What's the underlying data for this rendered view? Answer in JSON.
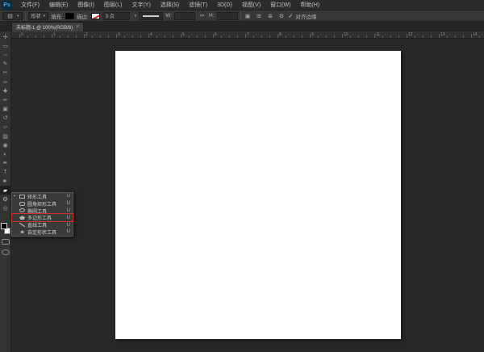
{
  "app": {
    "logo": "Ps"
  },
  "menubar": {
    "items": [
      {
        "label": "文件(F)"
      },
      {
        "label": "编辑(E)"
      },
      {
        "label": "图像(I)"
      },
      {
        "label": "图层(L)"
      },
      {
        "label": "文字(Y)"
      },
      {
        "label": "选择(S)"
      },
      {
        "label": "滤镜(T)"
      },
      {
        "label": "3D(D)"
      },
      {
        "label": "视图(V)"
      },
      {
        "label": "窗口(W)"
      },
      {
        "label": "帮助(H)"
      }
    ]
  },
  "options": {
    "preset_glyph": "▤",
    "preset_arrow": "▾",
    "shape_mode": "形状",
    "shape_mode_arrow": "▾",
    "fill_label": "填充:",
    "stroke_label": "描边:",
    "stroke_width": "3 点",
    "stroke_width_arrow": "▾",
    "w_label": "W:",
    "link_glyph": "∞",
    "h_label": "H:",
    "combine_glyph": "▣",
    "align_glyph": "⊞",
    "arrange_glyph": "≣",
    "gear_glyph": "⚙",
    "check_glyph": "✓",
    "align_edges_label": "对齐边缘"
  },
  "tab": {
    "title": "未标题-1 @ 100%(RGB/8)",
    "close": "×"
  },
  "ruler": {
    "numbers": [
      "0",
      "1",
      "2",
      "3",
      "4",
      "5",
      "6",
      "7",
      "8",
      "9",
      "10",
      "11",
      "12",
      "13",
      "14"
    ],
    "spacing_px": 40
  },
  "toolbar": {
    "tools": [
      {
        "name": "move-tool",
        "glyph": "✛"
      },
      {
        "name": "marquee-tool",
        "glyph": "▭"
      },
      {
        "name": "lasso-tool",
        "glyph": "∽"
      },
      {
        "name": "quick-selection-tool",
        "glyph": "✎"
      },
      {
        "name": "crop-tool",
        "glyph": "✂"
      },
      {
        "name": "eyedropper-tool",
        "glyph": "✑"
      },
      {
        "name": "healing-brush-tool",
        "glyph": "✚"
      },
      {
        "name": "brush-tool",
        "glyph": "✏"
      },
      {
        "name": "clone-stamp-tool",
        "glyph": "▣"
      },
      {
        "name": "history-brush-tool",
        "glyph": "↺"
      },
      {
        "name": "eraser-tool",
        "glyph": "▱"
      },
      {
        "name": "gradient-tool",
        "glyph": "▨"
      },
      {
        "name": "blur-tool",
        "glyph": "◉"
      },
      {
        "name": "dodge-tool",
        "glyph": "◐"
      },
      {
        "name": "pen-tool",
        "glyph": "✒"
      },
      {
        "name": "type-tool",
        "glyph": "T"
      },
      {
        "name": "path-selection-tool",
        "glyph": "►"
      },
      {
        "name": "shape-tool",
        "glyph": "▰",
        "active": true
      },
      {
        "name": "hand-tool",
        "glyph": "✪"
      },
      {
        "name": "zoom-tool",
        "glyph": "◎"
      }
    ]
  },
  "flyout": {
    "items": [
      {
        "label": "矩形工具",
        "shortcut": "U",
        "icon": "rectangle-icon",
        "active": true
      },
      {
        "label": "圆角矩形工具",
        "shortcut": "U",
        "icon": "rounded-rectangle-icon"
      },
      {
        "label": "椭圆工具",
        "shortcut": "U",
        "icon": "ellipse-icon"
      },
      {
        "label": "多边形工具",
        "shortcut": "U",
        "icon": "polygon-icon",
        "highlight": true
      },
      {
        "label": "直线工具",
        "shortcut": "U",
        "icon": "line-icon"
      },
      {
        "label": "自定形状工具",
        "shortcut": "U",
        "icon": "custom-shape-icon"
      }
    ]
  },
  "colors": {
    "highlight_red": "#d03030",
    "fill_swatch": "#000000",
    "canvas": "#ffffff",
    "ui_background": "#333333",
    "pasteboard": "#282828"
  }
}
